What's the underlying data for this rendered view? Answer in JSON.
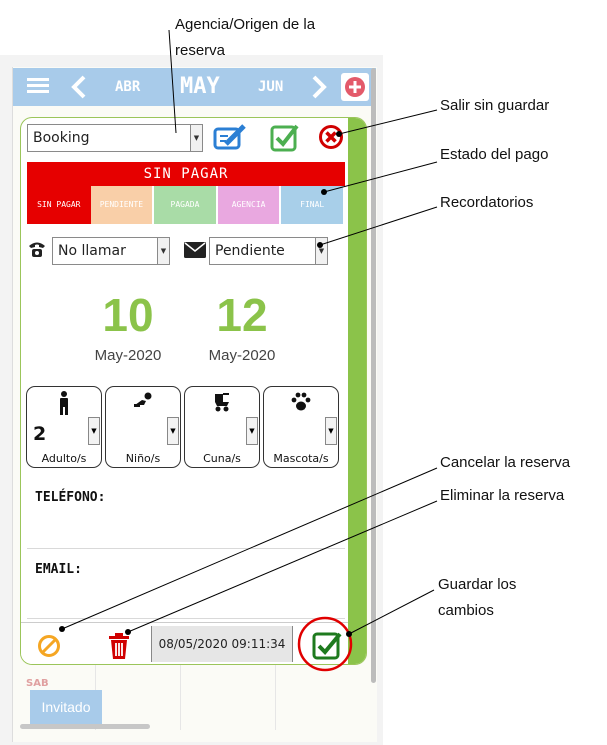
{
  "annotations": {
    "agencia_line1": "Agencia/Origen de la",
    "agencia_line2": "reserva",
    "salir": "Salir sin guardar",
    "estado": "Estado del pago",
    "recordatorios": "Recordatorios",
    "cancelar": "Cancelar la reserva",
    "eliminar": "Eliminar la reserva",
    "guardar_line1": "Guardar los",
    "guardar_line2": "cambios"
  },
  "calendar": {
    "prev_month": "ABR",
    "current_month": "MAY",
    "next_month": "JUN",
    "weekday_label": "SAB",
    "guest_button": "Invitado"
  },
  "booking": {
    "agency_value": "Booking",
    "payment_banner": "SIN PAGAR",
    "payment_tabs": [
      {
        "label": "SIN PAGAR",
        "color": "#e60000"
      },
      {
        "label": "PENDIENTE",
        "color": "#f9cfa8"
      },
      {
        "label": "PAGADA",
        "color": "#a9dca7"
      },
      {
        "label": "AGENCIA",
        "color": "#e9a8e0"
      },
      {
        "label": "FINAL",
        "color": "#a8cfe9"
      }
    ],
    "call_reminder": "No llamar",
    "email_reminder": "Pendiente",
    "checkin_day": "10",
    "checkin_month": "May-2020",
    "checkout_day": "12",
    "checkout_month": "May-2020",
    "guests": [
      {
        "label": "Adulto/s",
        "value": "2",
        "icon": "person-icon"
      },
      {
        "label": "Niño/s",
        "value": "",
        "icon": "baby-icon"
      },
      {
        "label": "Cuna/s",
        "value": "",
        "icon": "stroller-icon"
      },
      {
        "label": "Mascota/s",
        "value": "",
        "icon": "paw-icon"
      }
    ],
    "phone_label": "TELÉFONO:",
    "email_label": "EMAIL:",
    "timestamp": "08/05/2020 09:11:34"
  },
  "colors": {
    "accent_green": "#8bc34a",
    "header_blue": "#a8cbea",
    "alert_red": "#e60000"
  }
}
